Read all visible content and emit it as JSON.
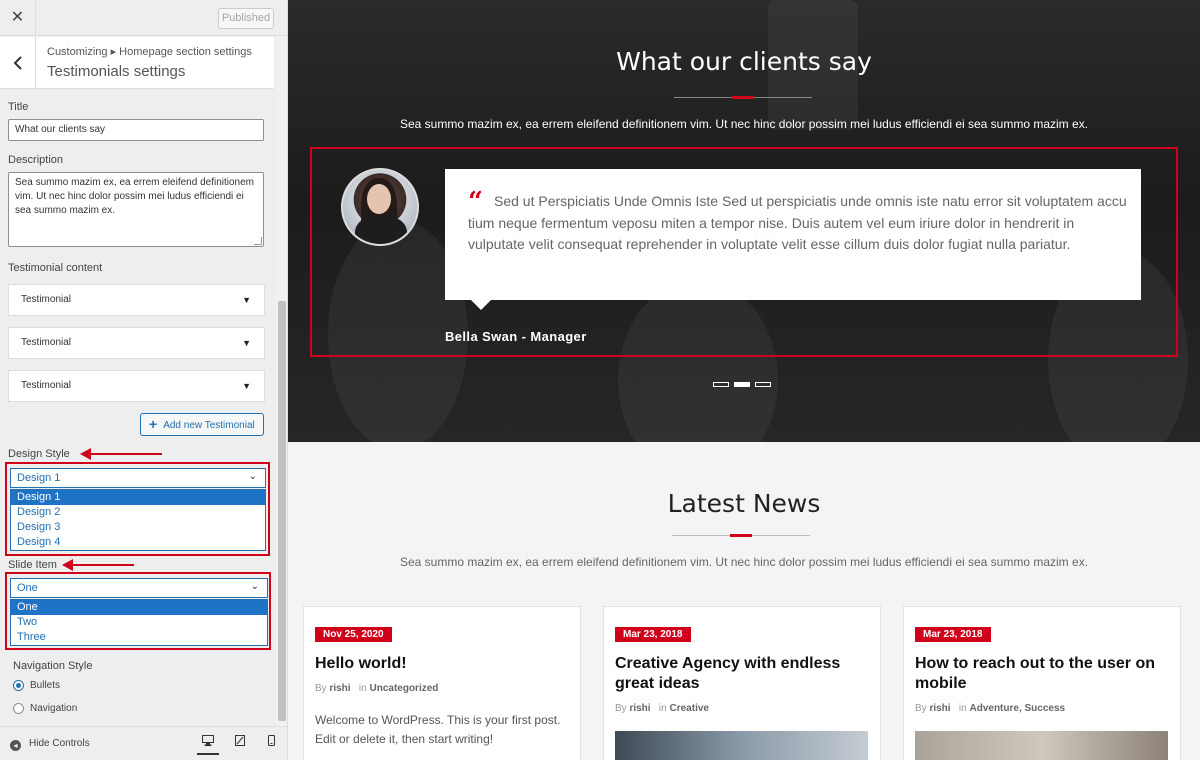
{
  "customizer": {
    "close_glyph": "✕",
    "publish_label": "Published",
    "breadcrumb": "Customizing ▸ Homepage section settings",
    "panel_title": "Testimonials settings",
    "title_label": "Title",
    "title_value": "What our clients say",
    "description_label": "Description",
    "description_value": "Sea summo mazim ex, ea errem eleifend definitionem vim. Ut nec hinc dolor possim mei ludus efficiendi ei sea summo mazim ex.",
    "testimonial_content_label": "Testimonial content",
    "testimonials": [
      {
        "label": "Testimonial"
      },
      {
        "label": "Testimonial"
      },
      {
        "label": "Testimonial"
      }
    ],
    "add_button_label": "Add new Testimonial",
    "design_style": {
      "label": "Design Style",
      "selected": "Design 1",
      "options": [
        "Design 1",
        "Design 2",
        "Design 3",
        "Design 4"
      ]
    },
    "slide_item": {
      "label": "Slide Item",
      "selected": "One",
      "options": [
        "One",
        "Two",
        "Three"
      ]
    },
    "navigation_style": {
      "label": "Navigation Style",
      "options": [
        {
          "label": "Bullets",
          "checked": true
        },
        {
          "label": "Navigation",
          "checked": false
        }
      ]
    },
    "hide_controls_label": "Hide Controls",
    "devices": [
      "desktop-icon",
      "tablet-icon",
      "mobile-icon"
    ]
  },
  "preview": {
    "testimonials_section": {
      "title": "What our clients say",
      "subtitle": "Sea summo mazim ex, ea errem eleifend definitionem vim. Ut nec hinc dolor possim mei ludus efficiendi ei sea summo mazim ex.",
      "quote": "Sed ut Perspiciatis Unde Omnis Iste Sed ut perspiciatis unde omnis iste natu error sit voluptatem accu tium neque fermentum veposu miten a tempor nise. Duis autem vel eum iriure dolor in hendrerit in vulputate velit consequat reprehender in voluptate velit esse cillum duis dolor fugiat nulla pariatur.",
      "author": "Bella Swan -  Manager",
      "slides_count": 3,
      "active_slide": 2
    },
    "news_section": {
      "title": "Latest News",
      "subtitle": "Sea summo mazim ex, ea errem eleifend definitionem vim. Ut nec hinc dolor possim mei ludus efficiendi ei sea summo mazim ex.",
      "posts": [
        {
          "date": "Nov 25, 2020",
          "title": "Hello world!",
          "by": "By",
          "author": "rishi",
          "in": "in",
          "categories": "Uncategorized",
          "excerpt": "Welcome to WordPress. This is your first post. Edit or delete it, then start writing!"
        },
        {
          "date": "Mar 23, 2018",
          "title": "Creative Agency with endless great ideas",
          "by": "By",
          "author": "rishi",
          "in": "in",
          "categories": "Creative"
        },
        {
          "date": "Mar 23, 2018",
          "title": "How to reach out to the user on mobile",
          "by": "By",
          "author": "rishi",
          "in": "in",
          "categories": "Adventure, Success"
        }
      ]
    }
  },
  "colors": {
    "accent": "#d0021b",
    "wp_blue": "#2271b1",
    "selected_option": "#1e73c6"
  }
}
